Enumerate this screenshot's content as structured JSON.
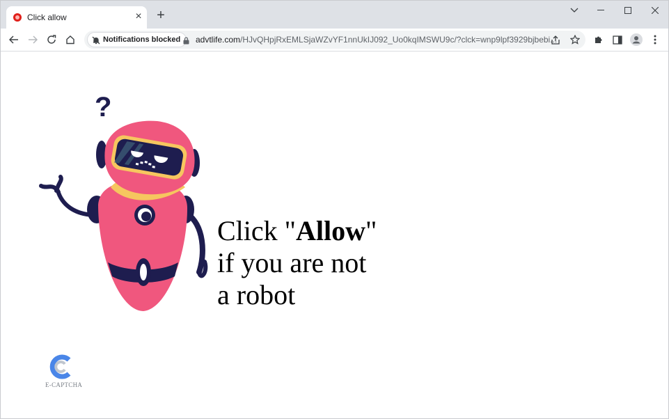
{
  "browser": {
    "tab": {
      "title": "Click allow"
    },
    "address": {
      "notification_chip": "Notifications blocked",
      "url_host": "advtlife.com",
      "url_rest": "/HJvQHpjRxEMLSjaWZvYF1nnUkIJ092_Uo0kqIMSWU9c/?clck=wnp9lpf3929bjbebi..."
    }
  },
  "page": {
    "headline": {
      "part1": "Click \"",
      "bold": "Allow",
      "part2": "\"",
      "line2": "if you are not",
      "line3": "a robot"
    },
    "captcha_label": "E-CAPTCHA"
  },
  "colors": {
    "robot_pink": "#f0577e",
    "robot_navy": "#1e1d4f",
    "robot_yellow": "#f6c65f",
    "captcha_blue": "#4a86e8"
  }
}
